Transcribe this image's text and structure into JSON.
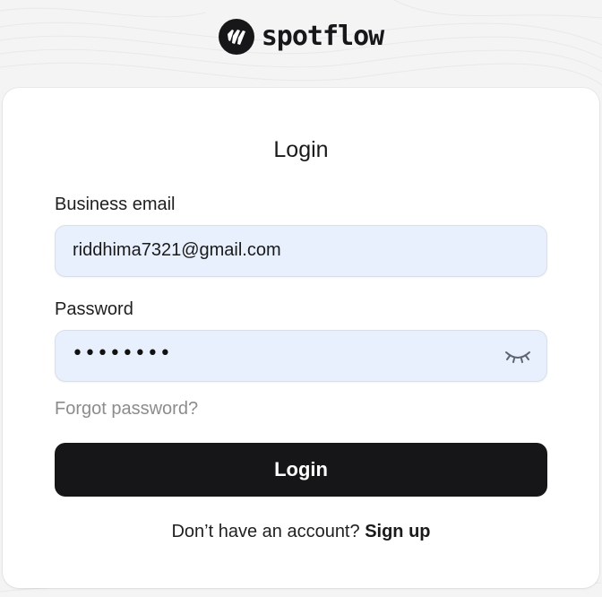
{
  "brand": {
    "name": "spotflow",
    "logo_icon": "spotflow-logo-icon",
    "color": "#17171a"
  },
  "login_form": {
    "title": "Login",
    "email_label": "Business email",
    "email_value": "riddhima7321@gmail.com",
    "password_label": "Password",
    "password_mask": "••••••••",
    "password_toggle_icon": "eye-closed-icon",
    "forgot_password": "Forgot password?",
    "submit_label": "Login",
    "signup_prompt": "Don’t have an account?",
    "signup_link": "Sign up"
  },
  "colors": {
    "page_background": "#f4f4f4",
    "card_background": "#ffffff",
    "input_background": "#e8f0fe",
    "button_background": "#161618",
    "muted_text": "#8c8c8c"
  }
}
